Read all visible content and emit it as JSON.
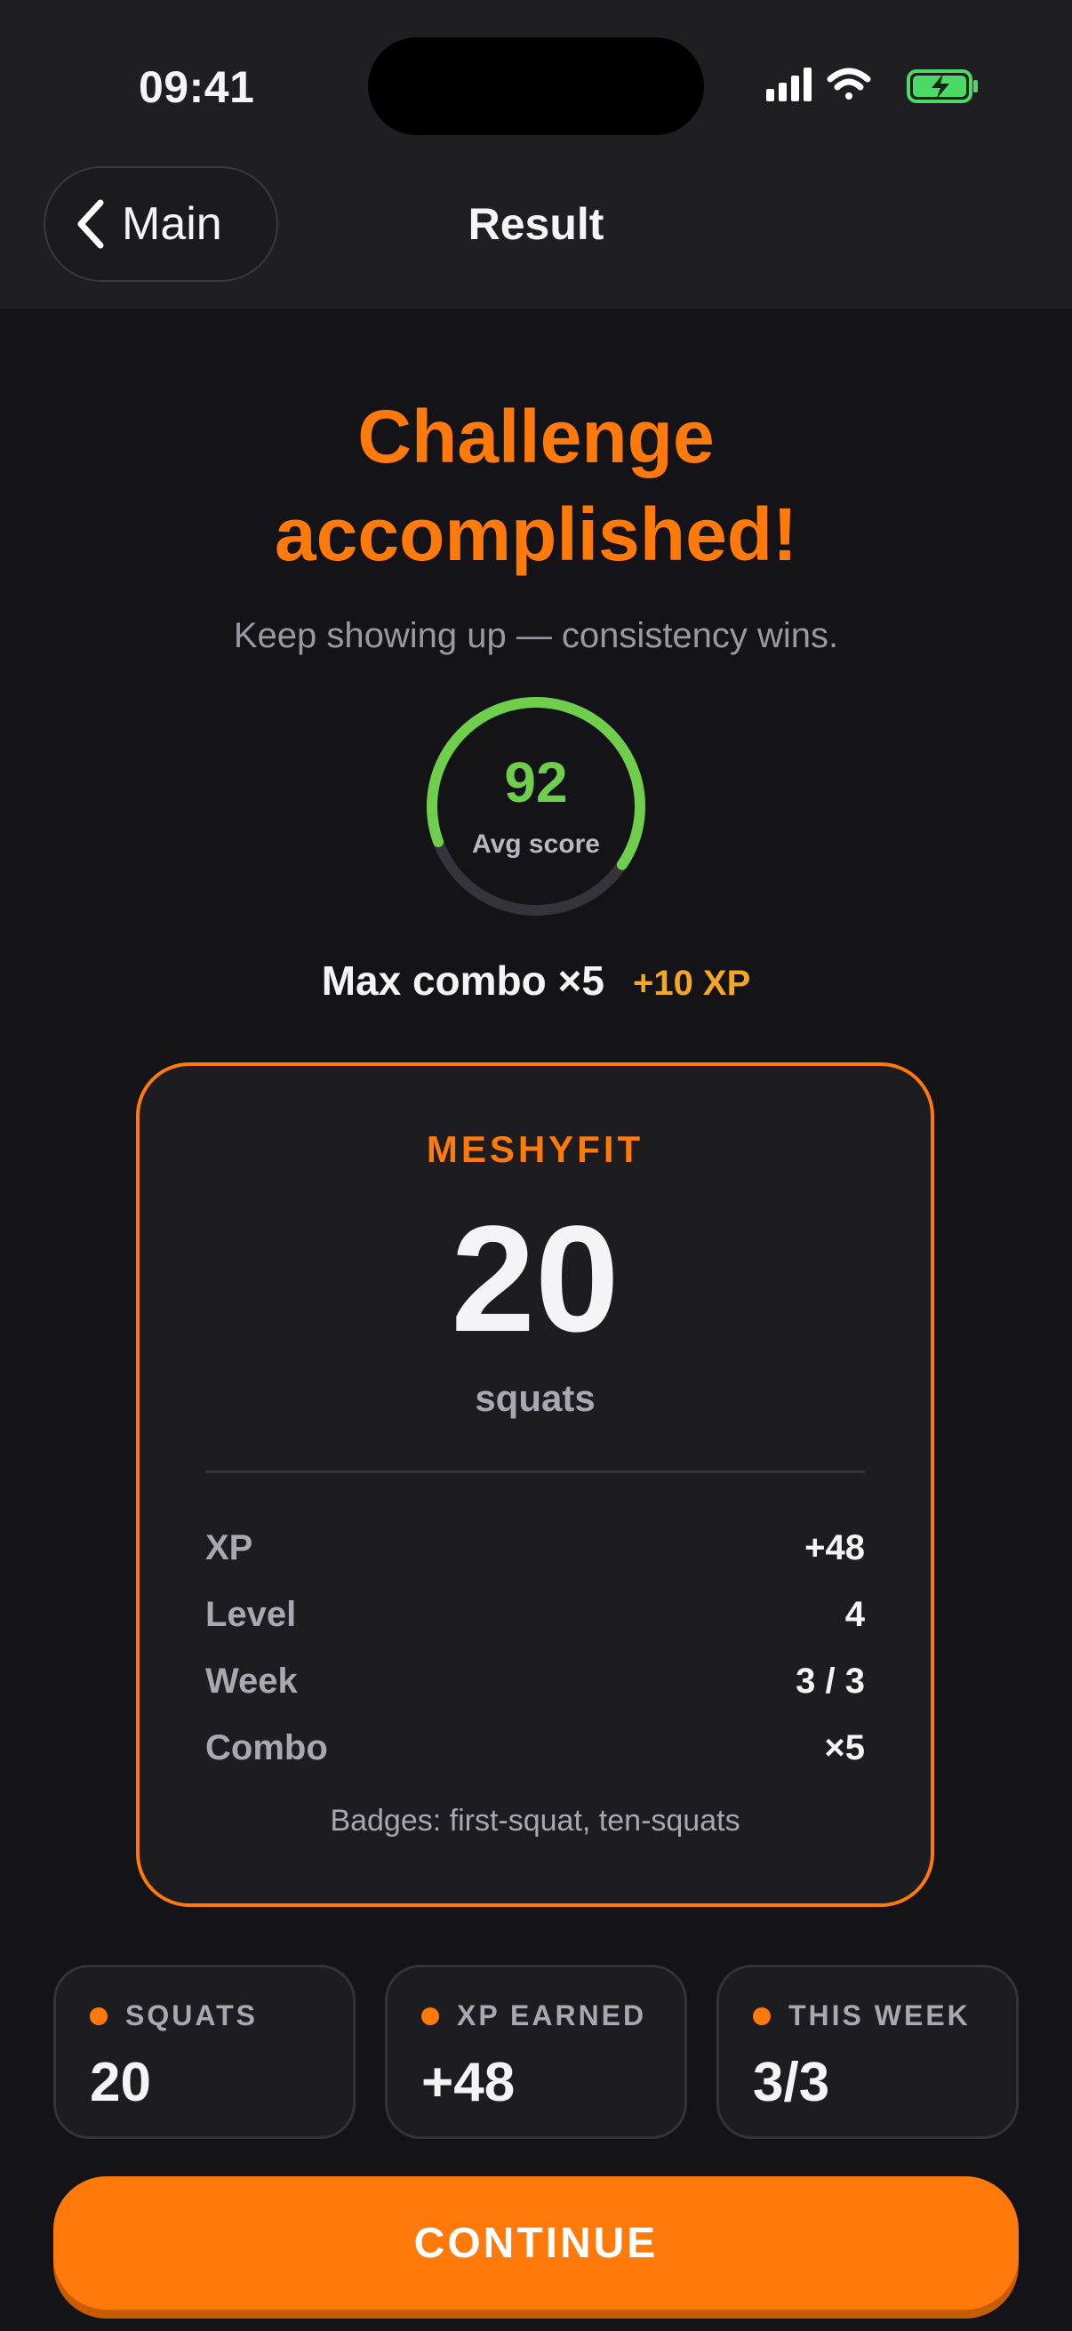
{
  "status_bar": {
    "time": "09:41",
    "battery": "charging"
  },
  "nav": {
    "back_label": "Main",
    "title": "Result"
  },
  "headline": {
    "line1": "Challenge",
    "line2": "accomplished!"
  },
  "subtitle": "Keep showing up — consistency wins.",
  "score": {
    "value": "92",
    "label": "Avg score",
    "fraction": 0.92
  },
  "combo": {
    "text": "Max combo ×5",
    "xp": "+10 XP"
  },
  "card": {
    "brand": "MESHYFIT",
    "count": "20",
    "unit": "squats",
    "stats": [
      {
        "label": "XP",
        "value": "+48"
      },
      {
        "label": "Level",
        "value": "4"
      },
      {
        "label": "Week",
        "value": "3 / 3"
      },
      {
        "label": "Combo",
        "value": "×5"
      }
    ],
    "badges": "Badges: first-squat, ten-squats"
  },
  "tiles": [
    {
      "label": "SQUATS",
      "value": "20"
    },
    {
      "label": "XP EARNED",
      "value": "+48"
    },
    {
      "label": "THIS WEEK",
      "value": "3/3"
    }
  ],
  "continue_label": "CONTINUE",
  "colors": {
    "accent": "#ff7a0a",
    "score_green": "#6fcf4c",
    "xp_gold": "#f5a623",
    "background": "#141317"
  }
}
